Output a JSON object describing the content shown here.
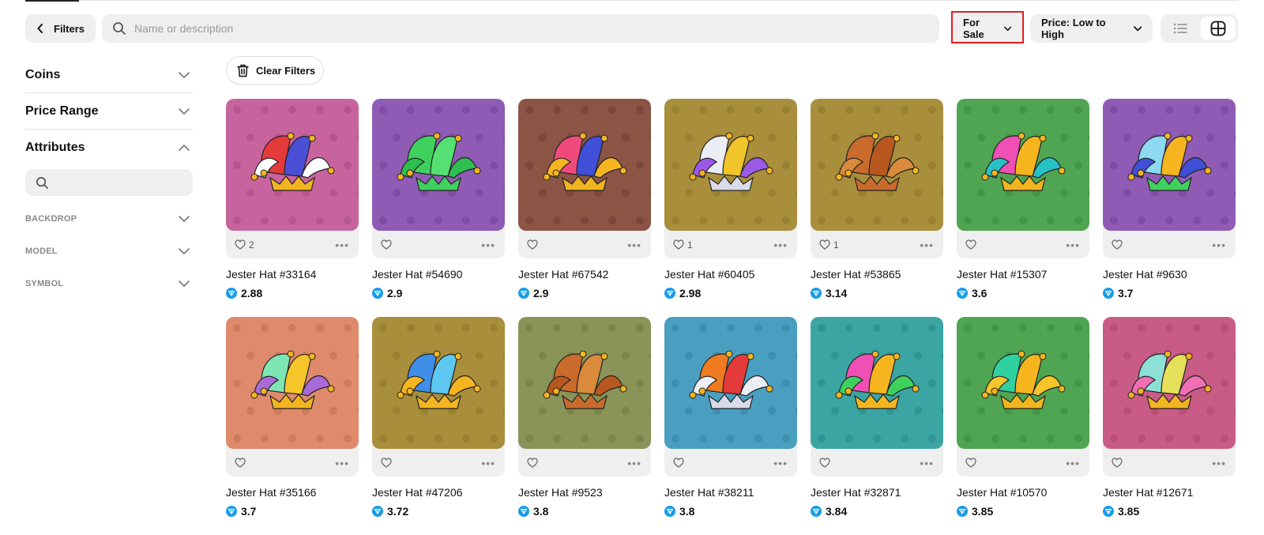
{
  "toolbar": {
    "filters_label": "Filters",
    "search_placeholder": "Name or description",
    "status_label": "For Sale",
    "sort_label": "Price: Low to High"
  },
  "sidebar": {
    "sections": [
      {
        "title": "Coins",
        "expanded": false
      },
      {
        "title": "Price Range",
        "expanded": false
      },
      {
        "title": "Attributes",
        "expanded": true
      }
    ],
    "attributes": [
      "BACKDROP",
      "MODEL",
      "SYMBOL"
    ]
  },
  "clear_filters_label": "Clear Filters",
  "currency_icon": "ton-diamond-icon",
  "items": [
    {
      "name": "Jester Hat #33164",
      "price": "2.88",
      "likes": "2",
      "bg": "#c7649e",
      "pattern": "#b55690",
      "hat": [
        "#e43a3a",
        "#4b4fd6",
        "#ffffff"
      ],
      "crown": "#f2b520"
    },
    {
      "name": "Jester Hat #54690",
      "price": "2.9",
      "likes": "",
      "bg": "#8f5bb4",
      "pattern": "#7f4da4",
      "hat": [
        "#3fd15e",
        "#55e073",
        "#2fbe50"
      ],
      "crown": "#3fd15e"
    },
    {
      "name": "Jester Hat #67542",
      "price": "2.9",
      "likes": "",
      "bg": "#8b5445",
      "pattern": "#7a473a",
      "hat": [
        "#f04a7c",
        "#3f4fd8",
        "#f6b51f"
      ],
      "crown": "#f2b520"
    },
    {
      "name": "Jester Hat #60405",
      "price": "2.98",
      "likes": "1",
      "bg": "#a98e3c",
      "pattern": "#998032",
      "hat": [
        "#ecedf5",
        "#f1c52a",
        "#9b59e6"
      ],
      "crown": "#d9dbe8"
    },
    {
      "name": "Jester Hat #53865",
      "price": "3.14",
      "likes": "1",
      "bg": "#a98e3c",
      "pattern": "#998032",
      "hat": [
        "#c96b2c",
        "#b8581f",
        "#d98a3a"
      ],
      "crown": "#c96b2c"
    },
    {
      "name": "Jester Hat #15307",
      "price": "3.6",
      "likes": "",
      "bg": "#4fa552",
      "pattern": "#439646",
      "hat": [
        "#f04fb5",
        "#f6b51f",
        "#26c1c5"
      ],
      "crown": "#f2b520"
    },
    {
      "name": "Jester Hat #9630",
      "price": "3.7",
      "likes": "",
      "bg": "#8f5bb4",
      "pattern": "#7f4da4",
      "hat": [
        "#8ed9f2",
        "#f6b51f",
        "#3f4fd8"
      ],
      "crown": "#3fd15e"
    },
    {
      "name": "Jester Hat #35166",
      "price": "3.7",
      "likes": "",
      "bg": "#df8a6c",
      "pattern": "#cf7a5c",
      "hat": [
        "#7ee6b4",
        "#f6c52a",
        "#a86bd8"
      ],
      "crown": "#f2b520"
    },
    {
      "name": "Jester Hat #47206",
      "price": "3.72",
      "likes": "",
      "bg": "#a98e3c",
      "pattern": "#998032",
      "hat": [
        "#3f8ee8",
        "#5fc8f2",
        "#f6b51f"
      ],
      "crown": "#f2b520"
    },
    {
      "name": "Jester Hat #9523",
      "price": "3.8",
      "likes": "",
      "bg": "#8a9459",
      "pattern": "#7b854b",
      "hat": [
        "#c96b2c",
        "#d98a3a",
        "#b8581f"
      ],
      "crown": "#c96b2c"
    },
    {
      "name": "Jester Hat #38211",
      "price": "3.8",
      "likes": "",
      "bg": "#4a9fc0",
      "pattern": "#3e8fae",
      "hat": [
        "#f07a1f",
        "#e43a3a",
        "#ecedf5"
      ],
      "crown": "#d9dbe8"
    },
    {
      "name": "Jester Hat #32871",
      "price": "3.84",
      "likes": "",
      "bg": "#3aa5a2",
      "pattern": "#2f9592",
      "hat": [
        "#f04fb5",
        "#f6b51f",
        "#3fd15e"
      ],
      "crown": "#f2b520"
    },
    {
      "name": "Jester Hat #10570",
      "price": "3.85",
      "likes": "",
      "bg": "#4fa552",
      "pattern": "#439646",
      "hat": [
        "#2fd1a0",
        "#f6b51f",
        "#f6c52a"
      ],
      "crown": "#f2b520"
    },
    {
      "name": "Jester Hat #12671",
      "price": "3.85",
      "likes": "",
      "bg": "#c95c86",
      "pattern": "#b94e78",
      "hat": [
        "#8de0d6",
        "#e6e05a",
        "#f06fb5"
      ],
      "crown": "#f2b520"
    }
  ]
}
